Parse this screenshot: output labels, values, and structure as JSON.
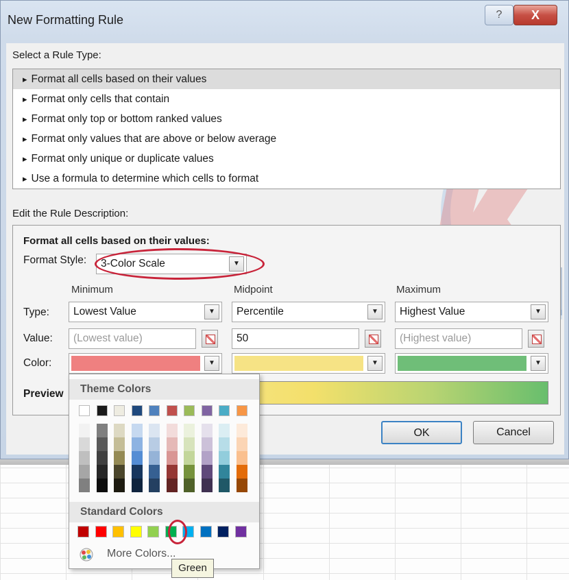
{
  "window": {
    "title": "New Formatting Rule",
    "help_label": "?",
    "close_label": "X"
  },
  "rule_type": {
    "heading": "Select a Rule Type:",
    "items": [
      "Format all cells based on their values",
      "Format only cells that contain",
      "Format only top or bottom ranked values",
      "Format only values that are above or below average",
      "Format only unique or duplicate values",
      "Use a formula to determine which cells to format"
    ],
    "selected_index": 0
  },
  "description": {
    "heading": "Edit the Rule Description:",
    "format_all_label": "Format all cells based on their values:",
    "format_style_label": "Format Style:",
    "format_style_value": "3-Color Scale",
    "columns": {
      "minimum": "Minimum",
      "midpoint": "Midpoint",
      "maximum": "Maximum"
    },
    "row_labels": {
      "type": "Type:",
      "value": "Value:",
      "color": "Color:"
    },
    "minimum": {
      "type": "Lowest Value",
      "value_placeholder": "(Lowest value)",
      "color": "#ef8080"
    },
    "midpoint": {
      "type": "Percentile",
      "value": "50",
      "color": "#f6e385"
    },
    "maximum": {
      "type": "Highest Value",
      "value_placeholder": "(Highest value)",
      "color": "#6fbe78"
    },
    "preview_label": "Preview"
  },
  "buttons": {
    "ok": "OK",
    "cancel": "Cancel"
  },
  "color_picker": {
    "theme_heading": "Theme Colors",
    "standard_heading": "Standard Colors",
    "more_colors_label": "More Colors...",
    "tooltip": "Green",
    "theme_columns": [
      [
        "#ffffff",
        "#f2f2f2",
        "#d9d9d9",
        "#bfbfbf",
        "#a6a6a6",
        "#808080"
      ],
      [
        "#1a1a1a",
        "#7f7f7f",
        "#595959",
        "#404040",
        "#262626",
        "#0d0d0d"
      ],
      [
        "#eeece1",
        "#ddd9c3",
        "#c4bd97",
        "#948a54",
        "#4a452a",
        "#1d1b10"
      ],
      [
        "#1f497d",
        "#c6d9f0",
        "#8db3e2",
        "#548dd4",
        "#17365d",
        "#0f243e"
      ],
      [
        "#4f81bd",
        "#dbe5f1",
        "#b8cce4",
        "#95b3d7",
        "#366092",
        "#244061"
      ],
      [
        "#c0504d",
        "#f2dcdb",
        "#e5b9b7",
        "#d99694",
        "#953734",
        "#632423"
      ],
      [
        "#9bbb59",
        "#ebf1dd",
        "#d7e3bc",
        "#c3d69b",
        "#76923c",
        "#4f6128"
      ],
      [
        "#8064a2",
        "#e5e0ec",
        "#ccc1d9",
        "#b2a2c7",
        "#5f497a",
        "#3f3151"
      ],
      [
        "#4bacc6",
        "#dbeef3",
        "#b7dde8",
        "#92cddc",
        "#31859b",
        "#205867"
      ],
      [
        "#f79646",
        "#fdeada",
        "#fbd5b5",
        "#fac08f",
        "#e36c09",
        "#974806"
      ]
    ],
    "standard_colors": [
      "#c00000",
      "#ff0000",
      "#ffc000",
      "#ffff00",
      "#92d050",
      "#00b050",
      "#00b0f0",
      "#0070c0",
      "#002060",
      "#7030a0"
    ],
    "selected_standard_index": 5
  }
}
